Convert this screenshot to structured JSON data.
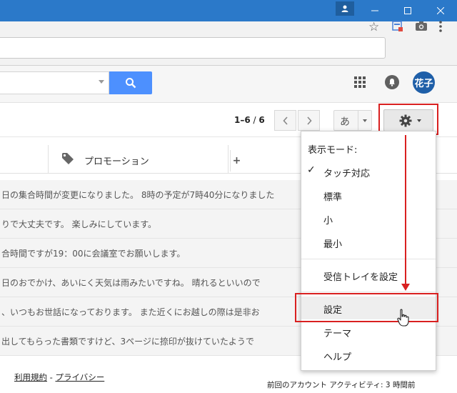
{
  "avatar": {
    "initials": "花子"
  },
  "pager": {
    "range": "1–6",
    "separator": " / ",
    "total": "6"
  },
  "input_tool": {
    "label": "あ"
  },
  "tabs": {
    "promotions": "プロモーション",
    "add": "+"
  },
  "messages": [
    "日の集合時間が変更になりました。 8時の予定が7時40分になりました",
    "りで大丈夫です。 楽しみにしています。",
    "合時間ですが19：00に会議室でお願いします。",
    "日のおでかけ、あいにく天気は雨みたいですね。 晴れるといいので",
    "、いつもお世話になっております。 また近くにお越しの際は是非お",
    "出してもらった書類ですけど、3ページに捺印が抜けていたようで"
  ],
  "footer": {
    "terms": "利用規約",
    "dash": " - ",
    "privacy": "プライバシー",
    "activity": "前回のアカウント アクティビティ: 3 時間前"
  },
  "settings_menu": {
    "header": "表示モード:",
    "items": {
      "touch": "タッチ対応",
      "standard": "標準",
      "small": "小",
      "smallest": "最小",
      "configure_inbox": "受信トレイを設定",
      "settings": "設定",
      "theme": "テーマ",
      "help": "ヘルプ"
    }
  },
  "colors": {
    "titlebar": "#2b79c9",
    "search_button": "#4d90fe",
    "avatar": "#1f5fa8",
    "annotation": "#d92020"
  }
}
